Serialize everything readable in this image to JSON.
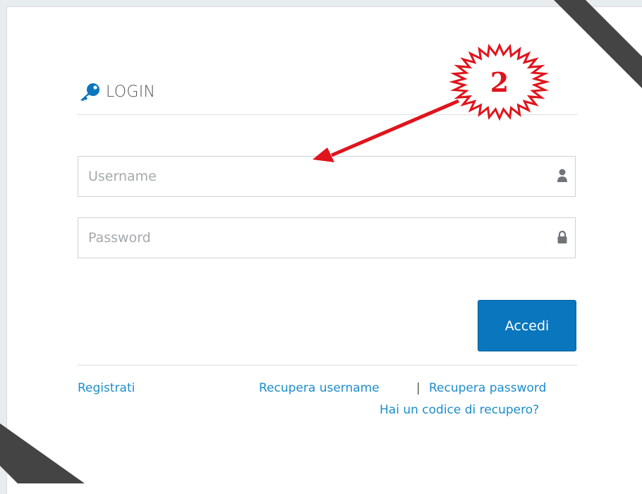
{
  "login": {
    "title": "LOGIN",
    "username_placeholder": "Username",
    "password_placeholder": "Password",
    "submit_label": "Accedi"
  },
  "links": {
    "register": "Registrati",
    "recover_username": "Recupera username",
    "separator": "|",
    "recover_password": "Recupera password",
    "recovery_code": "Hai un codice di recupero?"
  },
  "annotation": {
    "step_number": "2"
  },
  "icons": {
    "title_icon": "key-icon",
    "username_icon": "user-icon",
    "password_icon": "lock-icon"
  },
  "colors": {
    "accent": "#0a76bd",
    "link": "#1c8dcc",
    "annotation_red": "#e0141c"
  }
}
